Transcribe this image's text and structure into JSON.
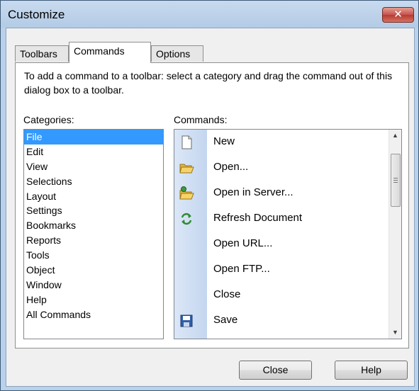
{
  "window": {
    "title": "Customize",
    "close_glyph": "✕"
  },
  "tabs": [
    {
      "label": "Toolbars",
      "active": false
    },
    {
      "label": "Commands",
      "active": true
    },
    {
      "label": "Options",
      "active": false
    }
  ],
  "description": "To add a command to a toolbar: select a category and drag the command out of this dialog box to a toolbar.",
  "categories": {
    "label": "Categories:",
    "selected": "File",
    "items": [
      "File",
      "Edit",
      "View",
      "Selections",
      "Layout",
      "Settings",
      "Bookmarks",
      "Reports",
      "Tools",
      "Object",
      "Window",
      "Help",
      "All Commands"
    ]
  },
  "commands": {
    "label": "Commands:",
    "items": [
      {
        "label": "New",
        "icon": "new-document-icon"
      },
      {
        "label": "Open...",
        "icon": "open-folder-icon"
      },
      {
        "label": "Open in Server...",
        "icon": "open-in-server-icon"
      },
      {
        "label": "Refresh Document",
        "icon": "refresh-icon"
      },
      {
        "label": "Open URL...",
        "icon": ""
      },
      {
        "label": "Open FTP...",
        "icon": ""
      },
      {
        "label": "Close",
        "icon": ""
      },
      {
        "label": "Save",
        "icon": "save-icon"
      }
    ]
  },
  "buttons": {
    "close": "Close",
    "help": "Help"
  },
  "colors": {
    "selection": "#3399ff",
    "close_button": "#c75050"
  }
}
